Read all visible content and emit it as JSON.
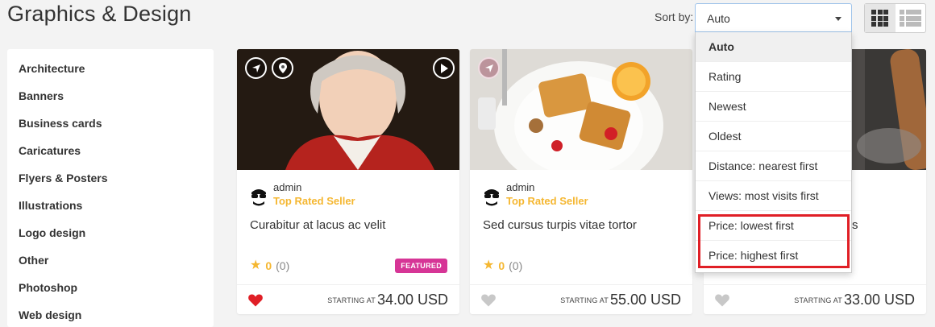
{
  "page": {
    "title": "Graphics & Design"
  },
  "sort": {
    "label": "Sort by:",
    "selected": "Auto",
    "options": [
      "Auto",
      "Rating",
      "Newest",
      "Oldest",
      "Distance: nearest first",
      "Views: most visits first",
      "Price: lowest first",
      "Price: highest first"
    ]
  },
  "view_toggle": {
    "grid_icon": "grid-view-icon",
    "list_icon": "list-view-icon",
    "active": "grid"
  },
  "sidebar": {
    "items": [
      {
        "label": "Architecture"
      },
      {
        "label": "Banners"
      },
      {
        "label": "Business cards"
      },
      {
        "label": "Caricatures"
      },
      {
        "label": "Flyers & Posters"
      },
      {
        "label": "Illustrations"
      },
      {
        "label": "Logo design"
      },
      {
        "label": "Other"
      },
      {
        "label": "Photoshop"
      },
      {
        "label": "Web design"
      }
    ]
  },
  "cards": [
    {
      "author": "admin",
      "seller_badge": "Top Rated Seller",
      "title": "Curabitur at lacus ac velit",
      "rating_score": "0",
      "rating_count": "(0)",
      "featured_label": "FEATURED",
      "starting_label": "STARTING AT",
      "price": "34.00 USD",
      "favorited": true
    },
    {
      "author": "admin",
      "seller_badge": "Top Rated Seller",
      "title": "Sed cursus turpis vitae tortor",
      "rating_score": "0",
      "rating_count": "(0)",
      "starting_label": "STARTING AT",
      "price": "55.00 USD",
      "favorited": false
    },
    {
      "title_tail": "s",
      "starting_label": "STARTING AT",
      "price": "33.00 USD",
      "favorited": false
    }
  ],
  "colors": {
    "accent_gold": "#f5b731",
    "featured_pink": "#d63596",
    "heart_red": "#e01f26",
    "highlight_red": "#e01f26"
  }
}
